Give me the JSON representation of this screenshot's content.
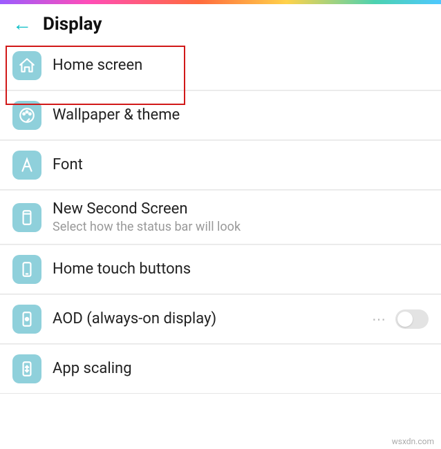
{
  "header": {
    "title": "Display"
  },
  "items": [
    {
      "label": "Home screen"
    },
    {
      "label": "Wallpaper & theme"
    },
    {
      "label": "Font"
    },
    {
      "label": "New Second Screen",
      "desc": "Select how the status bar will look"
    },
    {
      "label": "Home touch buttons"
    },
    {
      "label": "AOD (always-on display)"
    },
    {
      "label": "App scaling"
    }
  ],
  "watermark": "wsxdn.com"
}
